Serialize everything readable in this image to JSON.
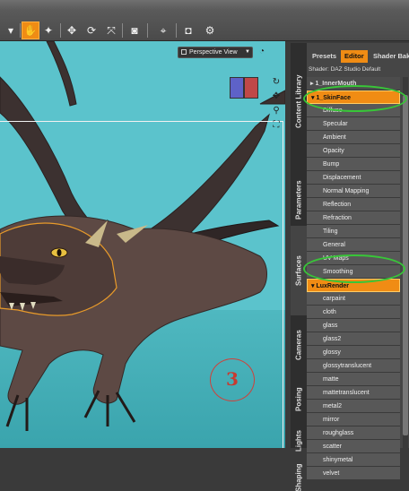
{
  "toolbar": {
    "icons": [
      "menu-triangle-icon",
      "scene-select-icon",
      "node-select-icon",
      "universal-tool-icon",
      "rotate-tool-icon",
      "translate-tool-icon",
      "camera-icon",
      "spot-render-icon",
      "render-icon",
      "render-settings-icon"
    ]
  },
  "viewport": {
    "view_label": "Perspective View",
    "annotation": "3"
  },
  "side_tabs": [
    "Content Library",
    "Parameters",
    "Surfaces",
    "Cameras",
    "Posing",
    "Lights",
    "Shaping"
  ],
  "panel": {
    "tabs": [
      "Presets",
      "Editor",
      "Shader Bak"
    ],
    "active_tab": "Editor",
    "shader_label": "Shader: DAZ Studio Default",
    "rows": [
      {
        "label": "▸ 1_InnerMouth",
        "kind": "parent"
      },
      {
        "label": "▾ 1_SkinFace",
        "kind": "sel"
      },
      {
        "label": "Diffuse",
        "kind": "child"
      },
      {
        "label": "Specular",
        "kind": "child"
      },
      {
        "label": "Ambient",
        "kind": "child"
      },
      {
        "label": "Opacity",
        "kind": "child"
      },
      {
        "label": "Bump",
        "kind": "child"
      },
      {
        "label": "Displacement",
        "kind": "child"
      },
      {
        "label": "Normal Mapping",
        "kind": "child"
      },
      {
        "label": "Reflection",
        "kind": "child"
      },
      {
        "label": "Refraction",
        "kind": "child"
      },
      {
        "label": "Tiling",
        "kind": "child"
      },
      {
        "label": "General",
        "kind": "child"
      },
      {
        "label": "UV Maps",
        "kind": "child"
      },
      {
        "label": "Smoothing",
        "kind": "child"
      },
      {
        "label": "▾ LuxRender",
        "kind": "sel"
      },
      {
        "label": "carpaint",
        "kind": "child"
      },
      {
        "label": "cloth",
        "kind": "child"
      },
      {
        "label": "glass",
        "kind": "child"
      },
      {
        "label": "glass2",
        "kind": "child"
      },
      {
        "label": "glossy",
        "kind": "child"
      },
      {
        "label": "glossytranslucent",
        "kind": "child"
      },
      {
        "label": "matte",
        "kind": "child"
      },
      {
        "label": "mattetranslucent",
        "kind": "child"
      },
      {
        "label": "metal2",
        "kind": "child"
      },
      {
        "label": "mirror",
        "kind": "child"
      },
      {
        "label": "roughglass",
        "kind": "child"
      },
      {
        "label": "scatter",
        "kind": "child"
      },
      {
        "label": "shinymetal",
        "kind": "child"
      },
      {
        "label": "velvet",
        "kind": "child"
      }
    ]
  },
  "colors": {
    "accent": "#f08c14",
    "highlight_ellipse": "#38c638",
    "viewport_bg": "#5bc3cc"
  }
}
